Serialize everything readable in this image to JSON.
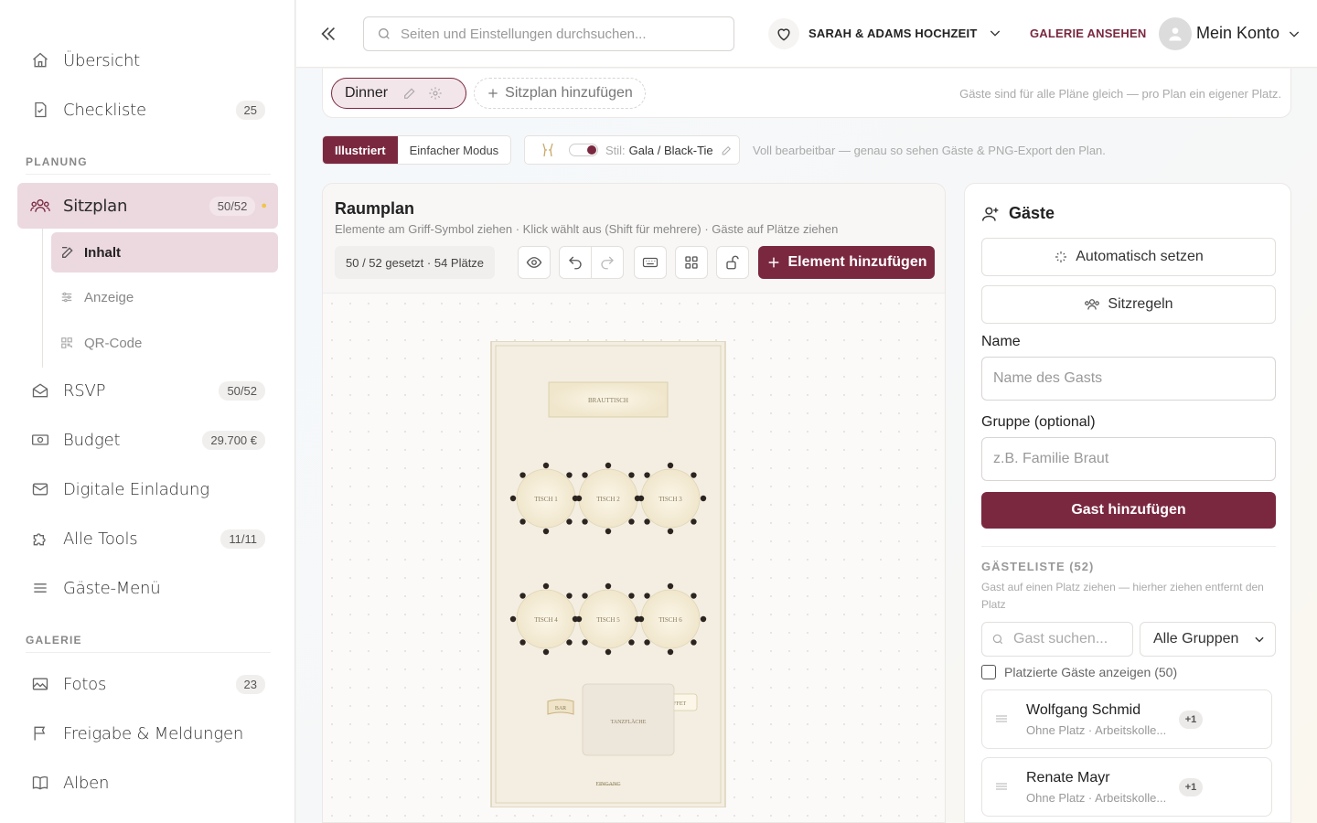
{
  "sidebar": {
    "items": [
      {
        "label": "Übersicht",
        "icon": "home-icon"
      },
      {
        "label": "Checkliste",
        "badge": "25",
        "icon": "checklist-icon"
      },
      {
        "label": "Sitzplan",
        "badge": "50/52",
        "icon": "users-icon"
      },
      {
        "label": "RSVP",
        "badge": "50/52",
        "icon": "mail-open-icon"
      },
      {
        "label": "Budget",
        "badge": "29.700 €",
        "icon": "money-icon"
      },
      {
        "label": "Digitale Einladung",
        "icon": "envelope-icon"
      },
      {
        "label": "Alle Tools",
        "badge": "11/11",
        "icon": "puzzle-icon"
      },
      {
        "label": "Gäste-Menü",
        "icon": "menu-icon"
      },
      {
        "label": "Fotos",
        "badge": "23",
        "icon": "image-icon"
      },
      {
        "label": "Freigabe & Meldungen",
        "icon": "flag-icon"
      },
      {
        "label": "Alben",
        "icon": "book-icon"
      }
    ],
    "sections": {
      "planning": "PLANUNG",
      "gallery": "GALERIE"
    },
    "subitems": [
      {
        "label": "Inhalt",
        "icon": "edit-icon"
      },
      {
        "label": "Anzeige",
        "icon": "sliders-icon"
      },
      {
        "label": "QR-Code",
        "icon": "qr-icon"
      }
    ]
  },
  "topbar": {
    "search_placeholder": "Seiten und Einstellungen durchsuchen...",
    "event_name": "SARAH & ADAMS HOCHZEIT",
    "gallery_link": "GALERIE ANSEHEN",
    "account_label": "Mein Konto"
  },
  "plans": {
    "active_plan": "Dinner",
    "add_label": "Sitzplan hinzufügen",
    "note": "Gäste sind für alle Pläne gleich — pro Plan ein eigener Platz."
  },
  "modes": {
    "illustrated": "Illustriert",
    "simple": "Einfacher Modus",
    "style_key": "Stil:",
    "style_value": "Gala / Black-Tie",
    "note": "Voll bearbeitbar — genau so sehen Gäste & PNG-Export den Plan."
  },
  "room": {
    "title": "Raumplan",
    "subtitle": "Elemente am Griff-Symbol ziehen · Klick wählt aus (Shift für mehrere) · Gäste auf Plätze ziehen",
    "count": "50 / 52 gesetzt · 54 Plätze",
    "add_element": "Element hinzufügen",
    "head_table": "BRAUTTISCH",
    "tables": [
      "TISCH 1",
      "TISCH 2",
      "TISCH 3",
      "TISCH 4",
      "TISCH 5",
      "TISCH 6"
    ],
    "labels": {
      "bar": "BAR",
      "buffet": "BUFFET",
      "dance": "TANZFLÄCHE",
      "entrance": "EINGANG"
    }
  },
  "guests": {
    "title": "Gäste",
    "auto_assign": "Automatisch setzen",
    "rules": "Sitzregeln",
    "name_label": "Name",
    "name_placeholder": "Name des Gasts",
    "group_label": "Gruppe (optional)",
    "group_placeholder": "z.B. Familie Braut",
    "submit": "Gast hinzufügen",
    "list_title": "GÄSTELISTE (52)",
    "list_note": "Gast auf einen Platz ziehen — hierher ziehen entfernt den Platz",
    "search_placeholder": "Gast suchen...",
    "group_filter": "Alle Gruppen",
    "show_placed": "Platzierte Gäste anzeigen (50)",
    "list": [
      {
        "name": "Wolfgang Schmid",
        "meta": "Ohne Platz · Arbeitskolle...",
        "plus": "+1"
      },
      {
        "name": "Renate Mayr",
        "meta": "Ohne Platz · Arbeitskolle...",
        "plus": "+1"
      }
    ]
  },
  "colors": {
    "accent": "#7a2840",
    "accent_light": "#ecd9df"
  }
}
